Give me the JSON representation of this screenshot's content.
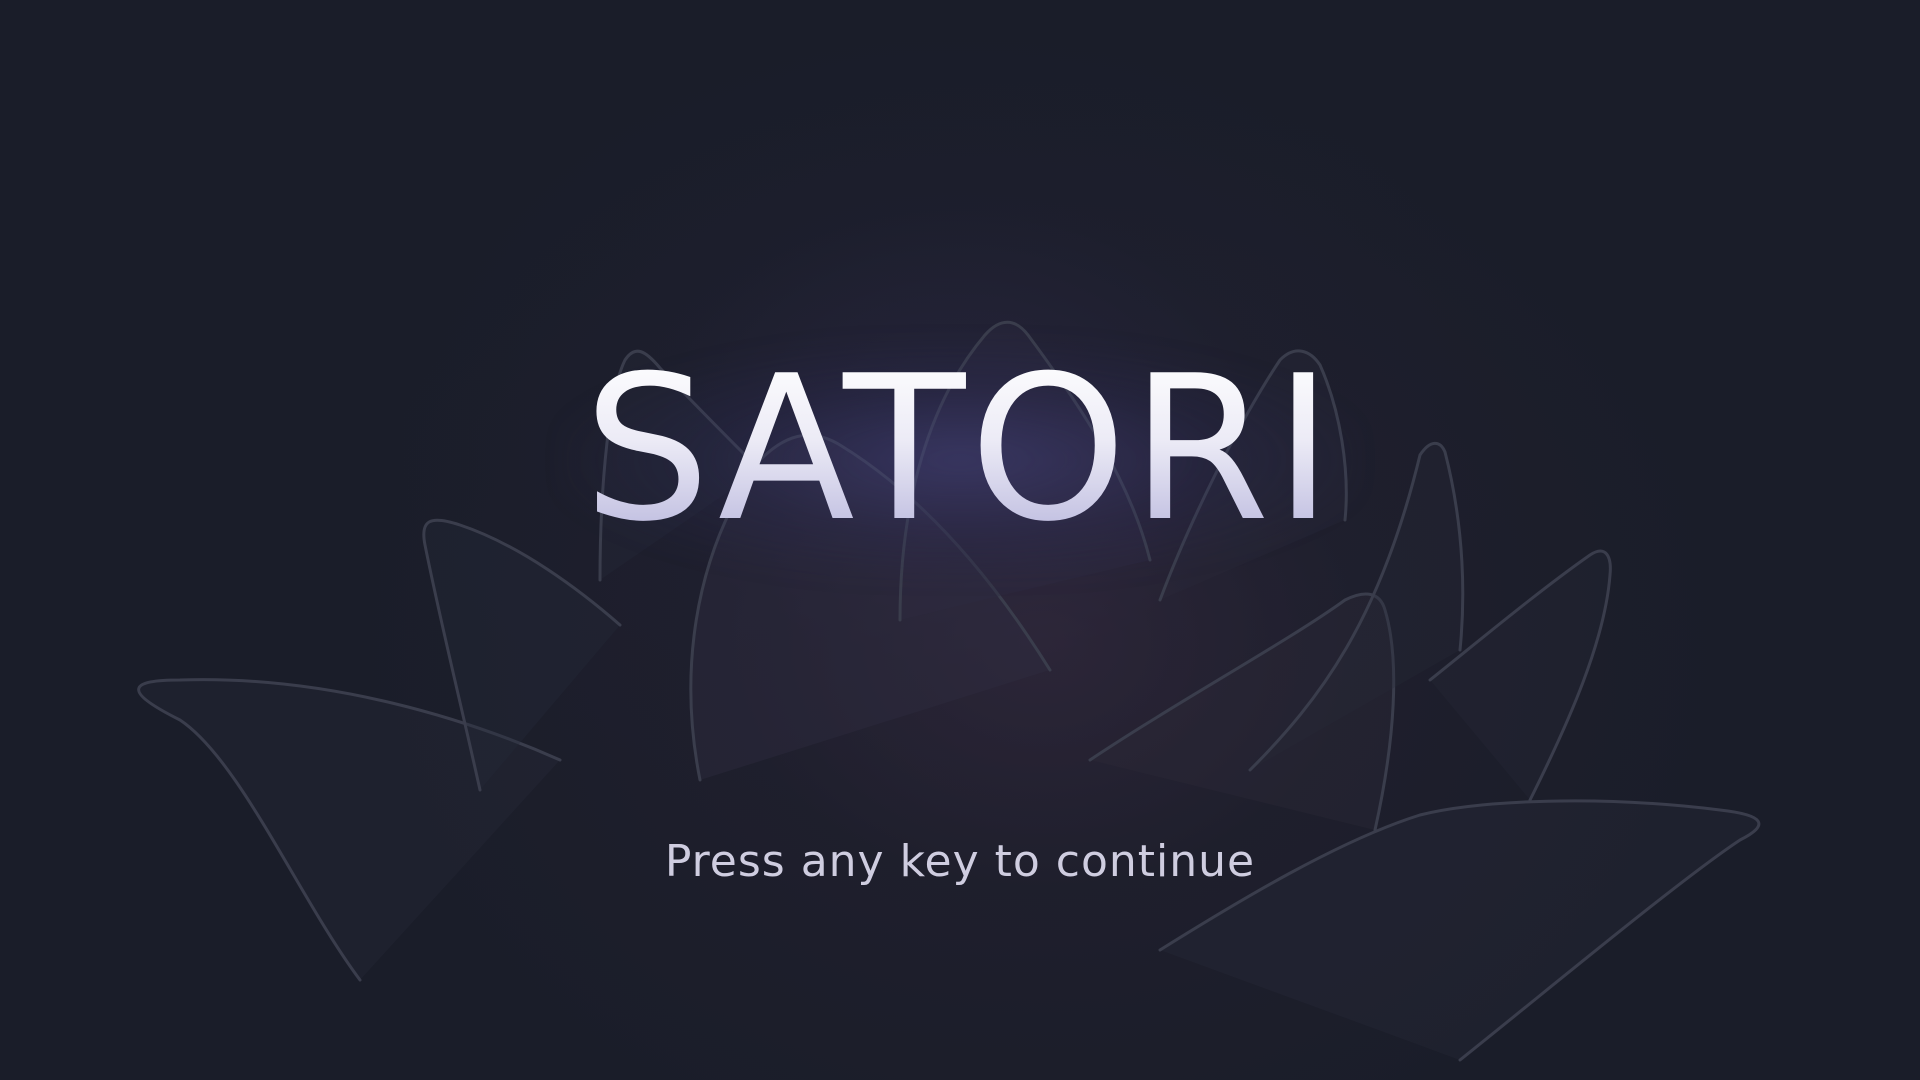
{
  "title_screen": {
    "game_title": "SATORI",
    "prompt": "Press any key to continue"
  },
  "background": {
    "motif": "lotus-flower-outline",
    "base_color": "#1a1d29",
    "petal_stroke_color": "#3a3d4c"
  },
  "title_colors": {
    "top": "#ffffff",
    "bottom": "#b7b5dc"
  },
  "prompt_color": "#cfcde0"
}
